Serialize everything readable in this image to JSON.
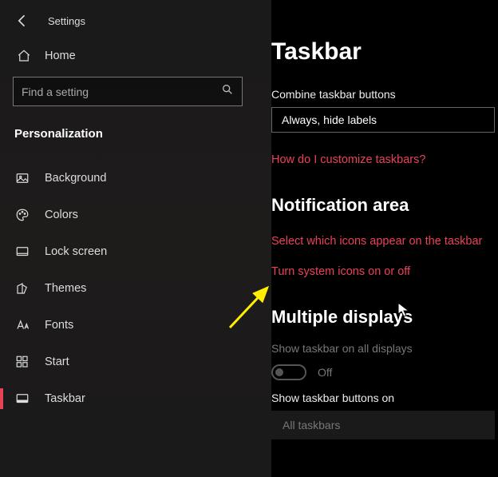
{
  "header": {
    "app_title": "Settings"
  },
  "search": {
    "placeholder": "Find a setting"
  },
  "home_label": "Home",
  "category": "Personalization",
  "subnav": [
    {
      "label": "Background"
    },
    {
      "label": "Colors"
    },
    {
      "label": "Lock screen"
    },
    {
      "label": "Themes"
    },
    {
      "label": "Fonts"
    },
    {
      "label": "Start"
    },
    {
      "label": "Taskbar"
    }
  ],
  "main": {
    "title": "Taskbar",
    "combine_label": "Combine taskbar buttons",
    "combine_value": "Always, hide labels",
    "customize_link": "How do I customize taskbars?",
    "notification_heading": "Notification area",
    "select_icons_link": "Select which icons appear on the taskbar",
    "system_icons_link": "Turn system icons on or off",
    "multi_heading": "Multiple displays",
    "show_all_label": "Show taskbar on all displays",
    "toggle_state": "Off",
    "show_buttons_label": "Show taskbar buttons on",
    "show_buttons_value": "All taskbars"
  }
}
